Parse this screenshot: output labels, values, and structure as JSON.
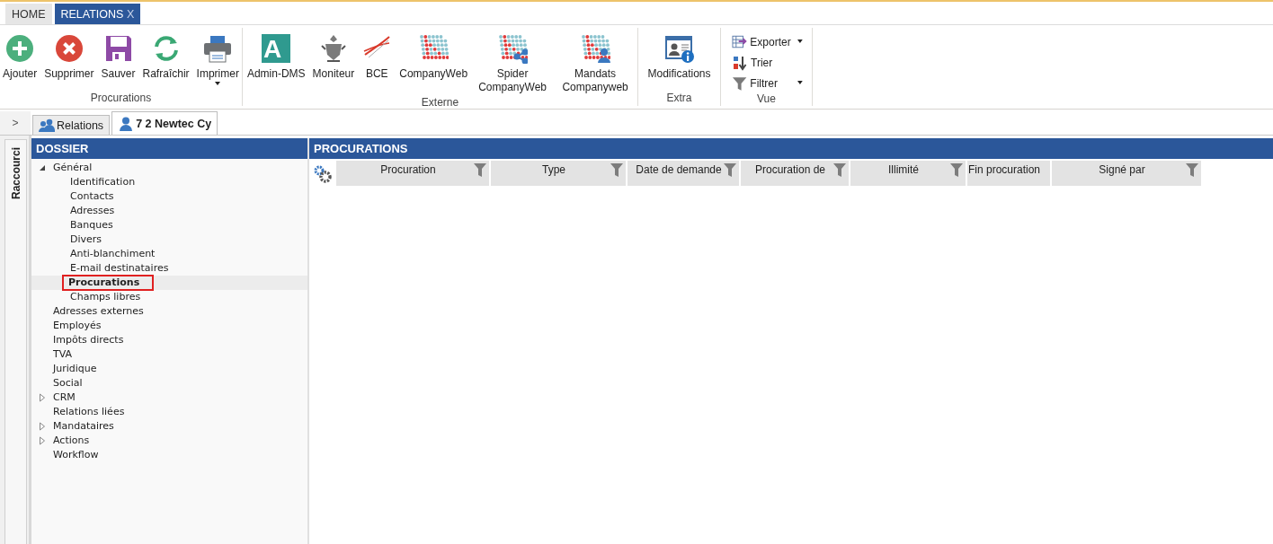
{
  "app_tabs": [
    {
      "label": "HOME",
      "selected": false
    },
    {
      "label": "RELATIONS",
      "selected": true,
      "close": "X"
    }
  ],
  "ribbon": {
    "groups": [
      {
        "label": "Procurations",
        "kind": "large",
        "buttons": [
          {
            "label": "Ajouter"
          },
          {
            "label": "Supprimer"
          },
          {
            "label": "Sauver"
          },
          {
            "label": "Rafraîchir"
          },
          {
            "label": "Imprimer",
            "dropdown": true
          }
        ]
      },
      {
        "label": "Externe",
        "kind": "large",
        "buttons": [
          {
            "label": "Admin-DMS",
            "logo_text": "A"
          },
          {
            "label": "Moniteur"
          },
          {
            "label": "BCE"
          },
          {
            "label": "CompanyWeb"
          },
          {
            "label": "Spider CompanyWeb"
          },
          {
            "label": "Mandats Companyweb"
          }
        ]
      },
      {
        "label": "Extra",
        "kind": "large",
        "buttons": [
          {
            "label": "Modifications"
          }
        ]
      },
      {
        "label": "Vue",
        "kind": "small",
        "buttons": [
          {
            "label": "Exporter",
            "dropdown": true
          },
          {
            "label": "Trier",
            "dropdown": false
          },
          {
            "label": "Filtrer",
            "dropdown": true
          }
        ]
      }
    ]
  },
  "expander": ">",
  "doc_tabs": [
    {
      "label": "Relations",
      "selected": false
    },
    {
      "label": "7 2 Newtec Cy",
      "selected": true
    }
  ],
  "shortcut_bar": {
    "label": "Raccourci"
  },
  "dossier": {
    "title": "DOSSIER",
    "items": [
      {
        "label": "Général",
        "expanded": true,
        "selected": false,
        "children": [
          {
            "label": "Identification",
            "selected": false
          },
          {
            "label": "Contacts",
            "selected": false
          },
          {
            "label": "Adresses",
            "selected": false
          },
          {
            "label": "Banques",
            "selected": false
          },
          {
            "label": "Divers",
            "selected": false
          },
          {
            "label": "Anti-blanchiment",
            "selected": false
          },
          {
            "label": "E-mail destinataires",
            "selected": false
          },
          {
            "label": "Procurations",
            "selected": true
          },
          {
            "label": "Champs libres",
            "selected": false
          }
        ]
      },
      {
        "label": "Adresses externes",
        "selected": false
      },
      {
        "label": "Employés",
        "selected": false
      },
      {
        "label": "Impôts directs",
        "selected": false
      },
      {
        "label": "TVA",
        "selected": false
      },
      {
        "label": "Juridique",
        "selected": false
      },
      {
        "label": "Social",
        "selected": false
      },
      {
        "label": "CRM",
        "expanded": false,
        "selected": false
      },
      {
        "label": "Relations liées",
        "selected": false
      },
      {
        "label": "Mandataires",
        "expanded": false,
        "selected": false
      },
      {
        "label": "Actions",
        "expanded": false,
        "selected": false
      },
      {
        "label": "Workflow",
        "selected": false
      }
    ]
  },
  "grid": {
    "title": "PROCURATIONS",
    "columns": [
      {
        "label": "Procuration",
        "filter": true
      },
      {
        "label": "Type",
        "filter": true
      },
      {
        "label": "Date de demande",
        "filter": true
      },
      {
        "label": "Procuration de",
        "filter": true
      },
      {
        "label": "Illimité",
        "filter": true
      },
      {
        "label": "Fin procuration",
        "filter": false
      },
      {
        "label": "Signé par",
        "filter": true
      }
    ]
  }
}
